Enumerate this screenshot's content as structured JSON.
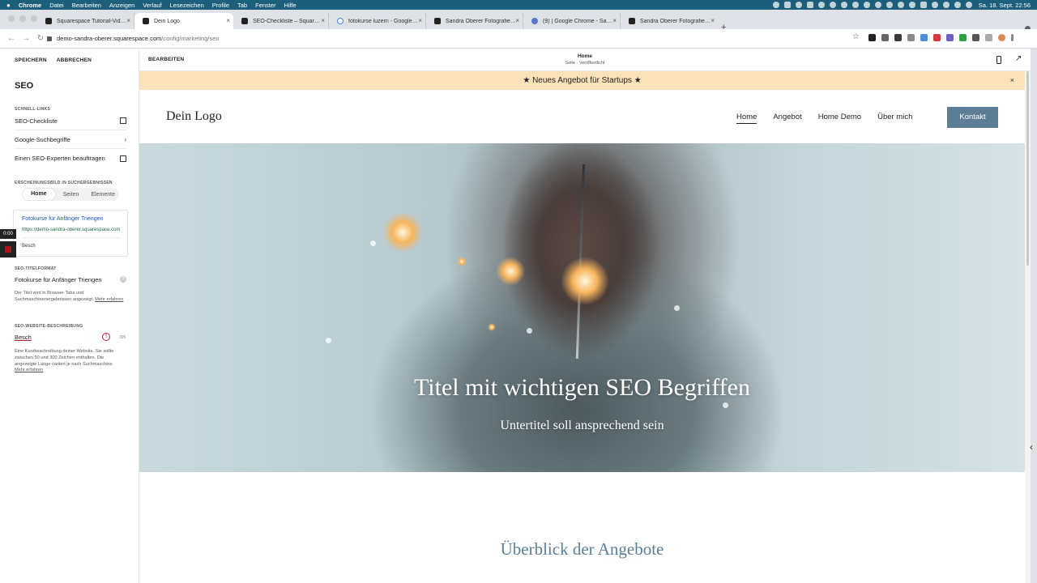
{
  "menubar": {
    "app": "Chrome",
    "items": [
      "Datei",
      "Bearbeiten",
      "Anzeigen",
      "Verlauf",
      "Lesezeichen",
      "Profile",
      "Tab",
      "Fenster",
      "Hilfe"
    ],
    "clock": "Sa. 18. Sept.  22:56"
  },
  "tabs": [
    {
      "label": "Squarespace Tutorial-Videos",
      "icon": "squarespace-icon"
    },
    {
      "label": "Dein Logo",
      "icon": "squarespace-icon",
      "active": true
    },
    {
      "label": "SEO-Checkliste – Squarespac",
      "icon": "squarespace-icon"
    },
    {
      "label": "fotokurse luzern - Google Such",
      "icon": "google-icon"
    },
    {
      "label": "Sandra Oberer Fotografie, Foto",
      "icon": "squarespace-icon"
    },
    {
      "label": "(9) | Google Chrome - Sandra",
      "icon": "chrome-icon"
    },
    {
      "label": "Sandra Oberer Fotografie, Foto",
      "icon": "squarespace-icon"
    }
  ],
  "url": {
    "host": "demo-sandra-oberer.squarespace.com",
    "path": "/config/marketing/seo"
  },
  "panel": {
    "save": "SPEICHERN",
    "cancel": "ABBRECHEN",
    "title": "SEO",
    "quicklinks_label": "SCHNELL-LINKS",
    "quicklinks": [
      "SEO-Checkliste",
      "Google-Suchbegriffe",
      "Einen SEO-Experten beauftragen"
    ],
    "appearance_label": "ERSCHEINUNGSBILD IN SUCHERGEBNISSEN",
    "segments": [
      "Home",
      "Seiten",
      "Elemente"
    ],
    "preview": {
      "title": "Fotokurse für Anfänger Triengen",
      "url": "https://demo-sandra-oberer.squarespace.com",
      "desc": "Besch"
    },
    "timer": "0:00",
    "title_format_label": "SEO-TITELFORMAT",
    "title_format_value": "Fotokurse für Anfänger Triengen",
    "title_hint": "Der Titel wird in Browser-Tabs und Suchmaschinenergebnissen angezeigt.",
    "title_hint_link": "Mehr erfahren",
    "desc_label": "SEO-WEBSITE-BESCHREIBUNG",
    "desc_value": "Besch",
    "desc_warn": "!",
    "desc_count": "395",
    "desc_hint": "Eine Kurzbeschreibung deiner Website. Sie sollte zwischen 50 und 300 Zeichen enthalten. Die angezeigte Länge variiert je nach Suchmaschine.",
    "desc_hint_link": "Mehr erfahren"
  },
  "editor": {
    "edit": "BEARBEITEN",
    "page": "Home",
    "page_status": "Seite · Veröffentlicht"
  },
  "site": {
    "banner": "★  Neues Angebot für Startups  ★",
    "banner_close": "×",
    "logo": "Dein Logo",
    "nav": [
      "Home",
      "Angebot",
      "Home Demo",
      "Über mich"
    ],
    "cta": "Kontakt",
    "hero_title": "Titel mit wichtigen SEO Begriffen",
    "hero_subtitle": "Untertitel soll ansprechend sein",
    "section_title": "Überblick der Angebote"
  },
  "colors": {
    "accent": "#5b7e96",
    "banner": "#fbe2b8",
    "warning": "#c01c3c",
    "menubar": "#1c5f7a"
  }
}
